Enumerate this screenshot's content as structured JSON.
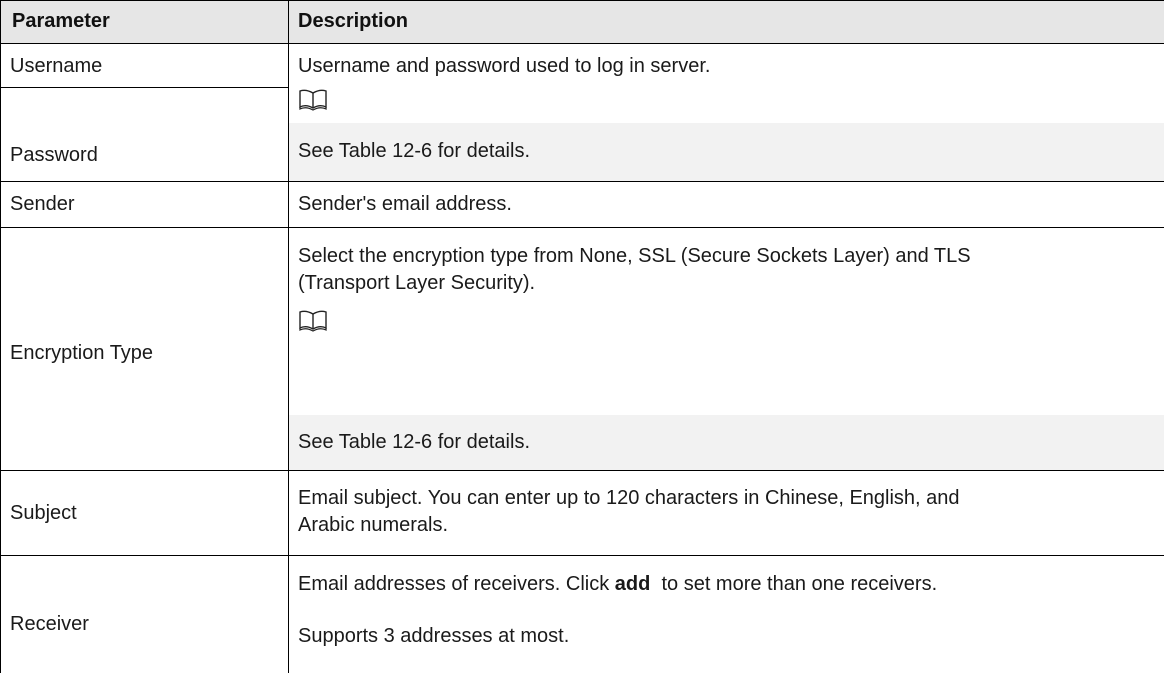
{
  "table": {
    "header": {
      "parameter": "Parameter",
      "description": "Description"
    },
    "rows": [
      {
        "param": "Username",
        "desc": "Username and password used to log in server."
      },
      {
        "param": "Password",
        "note_icon": "book-icon",
        "note": "See Table 12-6 for details."
      },
      {
        "param": "Sender",
        "desc": "Sender's email address."
      },
      {
        "param": "Encryption Type",
        "desc_line1": "Select the encryption type from None, SSL (Secure Sockets Layer) and TLS",
        "desc_line2": "(Transport Layer Security).",
        "note_icon": "book-icon",
        "note": "See Table 12-6 for details."
      },
      {
        "param": "Subject",
        "desc_line1": "Email subject. You can enter up to 120 characters in Chinese, English, and",
        "desc_line2": "Arabic numerals."
      },
      {
        "param": "Receiver",
        "desc_pre": "Email addresses of receivers. Click ",
        "desc_bold": "add",
        "desc_post": "  to set more than one receivers.",
        "desc_line2": "Supports 3 addresses at most."
      }
    ]
  },
  "colors": {
    "header_bg": "#e6e6e6",
    "note_bg": "#f2f2f2",
    "border": "#000000"
  }
}
